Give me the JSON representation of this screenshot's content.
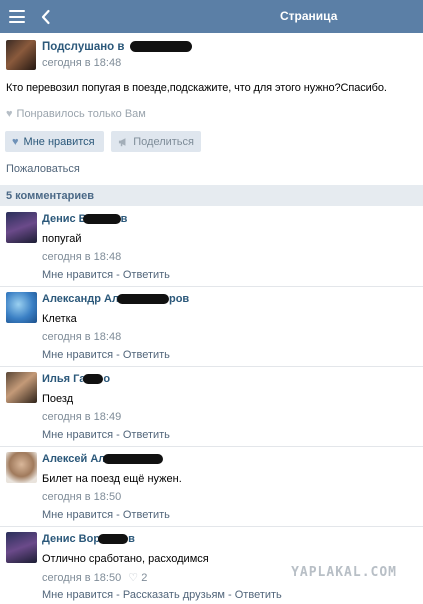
{
  "topbar": {
    "title": "Страница",
    "menu_icon": "menu-icon",
    "back_icon": "chevron-left-icon"
  },
  "post": {
    "author": "Подслушано в",
    "date": "сегодня в 18:48",
    "text": "Кто перевозил попугая в поезде,подскажите, что для этого нужно?Спасибо.",
    "liked_only": "Понравилось только Вам",
    "like_label": "Мне нравится",
    "share_label": "Поделиться",
    "report_label": "Пожаловаться"
  },
  "comments_header": "5 комментариев",
  "comments": [
    {
      "name": "Денис В",
      "name_tail": "в",
      "text": "попугай",
      "date": "сегодня в 18:48",
      "like": "Мне нравится",
      "sep": " - ",
      "reply": "Ответить"
    },
    {
      "name": "Александр Ал",
      "name_tail": "ров",
      "text": "Клетка",
      "date": "сегодня в 18:48",
      "like": "Мне нравится",
      "sep": " - ",
      "reply": "Ответить"
    },
    {
      "name": "Илья Га",
      "name_tail": "о",
      "text": "Поезд",
      "date": "сегодня в 18:49",
      "like": "Мне нравится",
      "sep": " - ",
      "reply": "Ответить"
    },
    {
      "name": "Алексей Ал",
      "name_tail": "",
      "text": "Билет на поезд ещё нужен.",
      "date": "сегодня в 18:50",
      "like": "Мне нравится",
      "sep": " - ",
      "reply": "Ответить"
    },
    {
      "name": "Денис Вор",
      "name_tail": "в",
      "text": "Отлично сработано, расходимся",
      "date": "сегодня в 18:50",
      "likes_count": "2",
      "like": "Мне нравится",
      "sep": " - ",
      "share": "Рассказать друзьям",
      "reply": "Ответить"
    }
  ],
  "watermark": "YAPLAKAL.COM",
  "colors": {
    "topbar": "#5b7fa6",
    "link": "#2b587a",
    "muted": "#7f8c98",
    "header_bg": "#e6ebf0"
  }
}
